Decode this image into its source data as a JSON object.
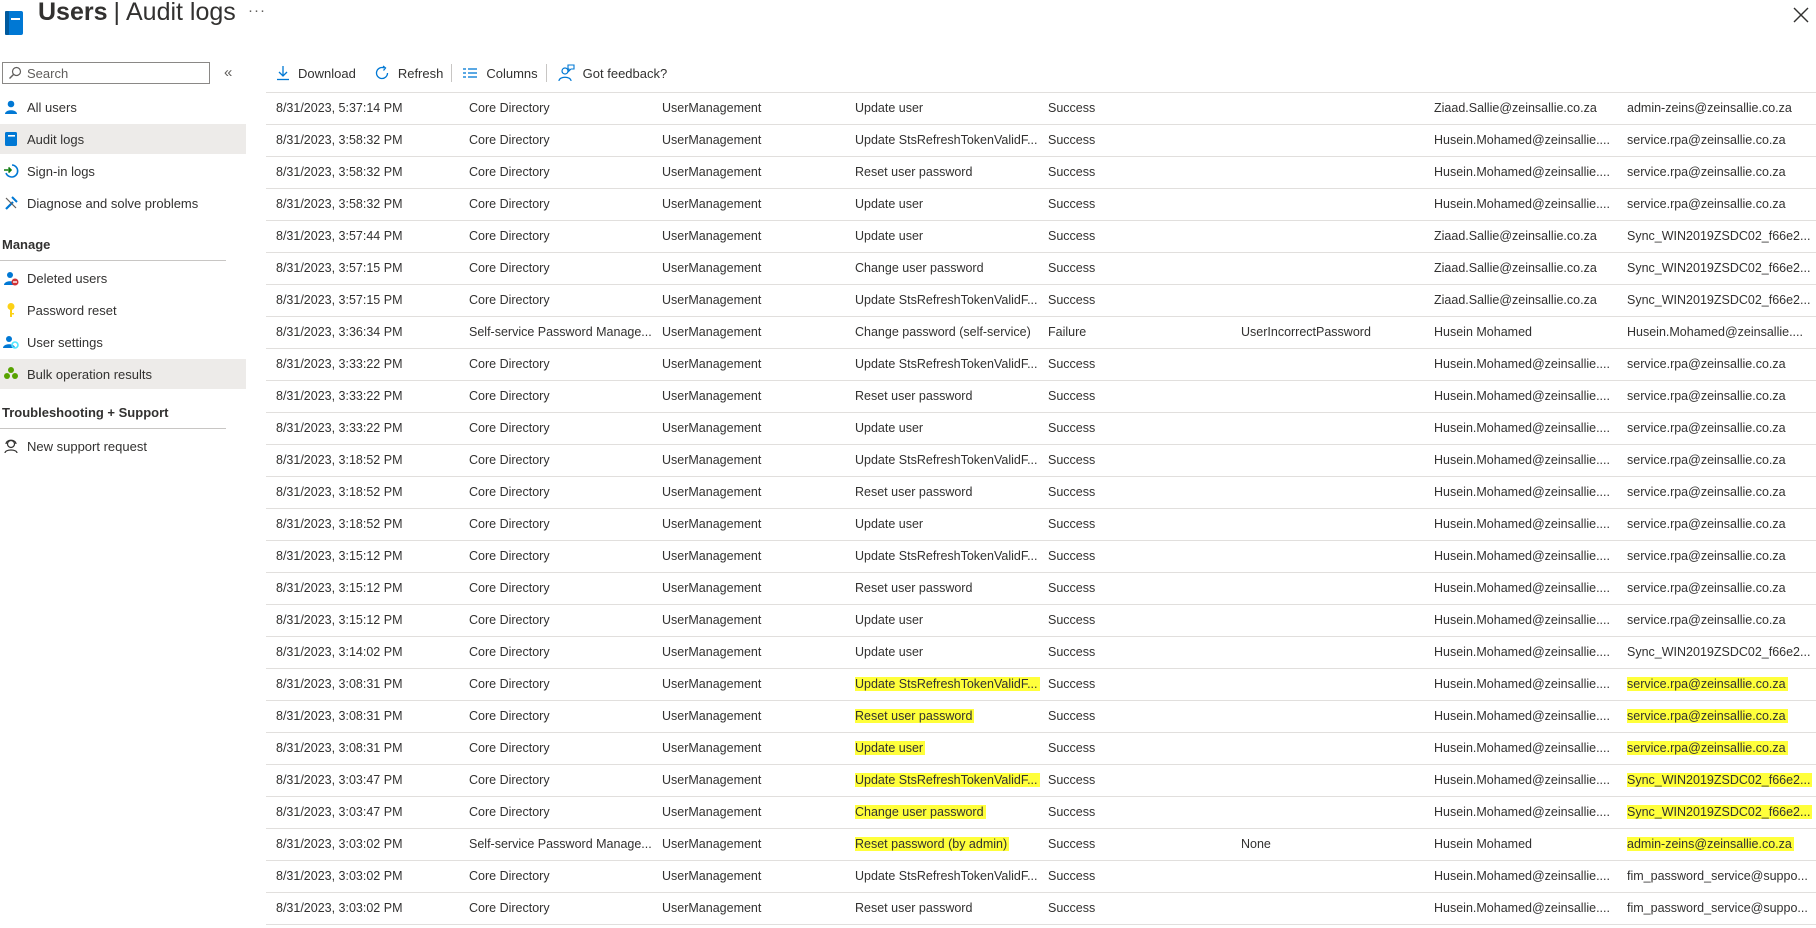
{
  "header": {
    "title_main": "Users",
    "title_sub": "Audit logs",
    "more_label": "···"
  },
  "sidebar": {
    "search_placeholder": "Search",
    "items": [
      {
        "label": "All users"
      },
      {
        "label": "Audit logs"
      },
      {
        "label": "Sign-in logs"
      },
      {
        "label": "Diagnose and solve problems"
      }
    ],
    "manage_title": "Manage",
    "manage_items": [
      {
        "label": "Deleted users"
      },
      {
        "label": "Password reset"
      },
      {
        "label": "User settings"
      },
      {
        "label": "Bulk operation results"
      }
    ],
    "support_title": "Troubleshooting + Support",
    "support_items": [
      {
        "label": "New support request"
      }
    ]
  },
  "toolbar": {
    "download": "Download",
    "refresh": "Refresh",
    "columns": "Columns",
    "feedback": "Got feedback?"
  },
  "colors": {
    "accent": "#0078d4",
    "highlight": "#ffff3b",
    "border": "#e1dfdd"
  },
  "rows": [
    [
      "8/31/2023, 5:37:14 PM",
      "Core Directory",
      "UserManagement",
      "Update user",
      "Success",
      "",
      "Ziaad.Sallie@zeinsallie.co.za",
      "admin-zeins@zeinsallie.co.za"
    ],
    [
      "8/31/2023, 3:58:32 PM",
      "Core Directory",
      "UserManagement",
      "Update StsRefreshTokenValidF...",
      "Success",
      "",
      "Husein.Mohamed@zeinsallie....",
      "service.rpa@zeinsallie.co.za"
    ],
    [
      "8/31/2023, 3:58:32 PM",
      "Core Directory",
      "UserManagement",
      "Reset user password",
      "Success",
      "",
      "Husein.Mohamed@zeinsallie....",
      "service.rpa@zeinsallie.co.za"
    ],
    [
      "8/31/2023, 3:58:32 PM",
      "Core Directory",
      "UserManagement",
      "Update user",
      "Success",
      "",
      "Husein.Mohamed@zeinsallie....",
      "service.rpa@zeinsallie.co.za"
    ],
    [
      "8/31/2023, 3:57:44 PM",
      "Core Directory",
      "UserManagement",
      "Update user",
      "Success",
      "",
      "Ziaad.Sallie@zeinsallie.co.za",
      "Sync_WIN2019ZSDC02_f66e2..."
    ],
    [
      "8/31/2023, 3:57:15 PM",
      "Core Directory",
      "UserManagement",
      "Change user password",
      "Success",
      "",
      "Ziaad.Sallie@zeinsallie.co.za",
      "Sync_WIN2019ZSDC02_f66e2..."
    ],
    [
      "8/31/2023, 3:57:15 PM",
      "Core Directory",
      "UserManagement",
      "Update StsRefreshTokenValidF...",
      "Success",
      "",
      "Ziaad.Sallie@zeinsallie.co.za",
      "Sync_WIN2019ZSDC02_f66e2..."
    ],
    [
      "8/31/2023, 3:36:34 PM",
      "Self-service Password Manage...",
      "UserManagement",
      "Change password (self-service)",
      "Failure",
      "UserIncorrectPassword",
      "Husein Mohamed",
      "Husein.Mohamed@zeinsallie...."
    ],
    [
      "8/31/2023, 3:33:22 PM",
      "Core Directory",
      "UserManagement",
      "Update StsRefreshTokenValidF...",
      "Success",
      "",
      "Husein.Mohamed@zeinsallie....",
      "service.rpa@zeinsallie.co.za"
    ],
    [
      "8/31/2023, 3:33:22 PM",
      "Core Directory",
      "UserManagement",
      "Reset user password",
      "Success",
      "",
      "Husein.Mohamed@zeinsallie....",
      "service.rpa@zeinsallie.co.za"
    ],
    [
      "8/31/2023, 3:33:22 PM",
      "Core Directory",
      "UserManagement",
      "Update user",
      "Success",
      "",
      "Husein.Mohamed@zeinsallie....",
      "service.rpa@zeinsallie.co.za"
    ],
    [
      "8/31/2023, 3:18:52 PM",
      "Core Directory",
      "UserManagement",
      "Update StsRefreshTokenValidF...",
      "Success",
      "",
      "Husein.Mohamed@zeinsallie....",
      "service.rpa@zeinsallie.co.za"
    ],
    [
      "8/31/2023, 3:18:52 PM",
      "Core Directory",
      "UserManagement",
      "Reset user password",
      "Success",
      "",
      "Husein.Mohamed@zeinsallie....",
      "service.rpa@zeinsallie.co.za"
    ],
    [
      "8/31/2023, 3:18:52 PM",
      "Core Directory",
      "UserManagement",
      "Update user",
      "Success",
      "",
      "Husein.Mohamed@zeinsallie....",
      "service.rpa@zeinsallie.co.za"
    ],
    [
      "8/31/2023, 3:15:12 PM",
      "Core Directory",
      "UserManagement",
      "Update StsRefreshTokenValidF...",
      "Success",
      "",
      "Husein.Mohamed@zeinsallie....",
      "service.rpa@zeinsallie.co.za"
    ],
    [
      "8/31/2023, 3:15:12 PM",
      "Core Directory",
      "UserManagement",
      "Reset user password",
      "Success",
      "",
      "Husein.Mohamed@zeinsallie....",
      "service.rpa@zeinsallie.co.za"
    ],
    [
      "8/31/2023, 3:15:12 PM",
      "Core Directory",
      "UserManagement",
      "Update user",
      "Success",
      "",
      "Husein.Mohamed@zeinsallie....",
      "service.rpa@zeinsallie.co.za"
    ],
    [
      "8/31/2023, 3:14:02 PM",
      "Core Directory",
      "UserManagement",
      "Update user",
      "Success",
      "",
      "Husein.Mohamed@zeinsallie....",
      "Sync_WIN2019ZSDC02_f66e2..."
    ],
    [
      "8/31/2023, 3:08:31 PM",
      "Core Directory",
      "UserManagement",
      "Update StsRefreshTokenValidF...",
      "Success",
      "",
      "Husein.Mohamed@zeinsallie....",
      "service.rpa@zeinsallie.co.za"
    ],
    [
      "8/31/2023, 3:08:31 PM",
      "Core Directory",
      "UserManagement",
      "Reset user password",
      "Success",
      "",
      "Husein.Mohamed@zeinsallie....",
      "service.rpa@zeinsallie.co.za"
    ],
    [
      "8/31/2023, 3:08:31 PM",
      "Core Directory",
      "UserManagement",
      "Update user",
      "Success",
      "",
      "Husein.Mohamed@zeinsallie....",
      "service.rpa@zeinsallie.co.za"
    ],
    [
      "8/31/2023, 3:03:47 PM",
      "Core Directory",
      "UserManagement",
      "Update StsRefreshTokenValidF...",
      "Success",
      "",
      "Husein.Mohamed@zeinsallie....",
      "Sync_WIN2019ZSDC02_f66e2..."
    ],
    [
      "8/31/2023, 3:03:47 PM",
      "Core Directory",
      "UserManagement",
      "Change user password",
      "Success",
      "",
      "Husein.Mohamed@zeinsallie....",
      "Sync_WIN2019ZSDC02_f66e2..."
    ],
    [
      "8/31/2023, 3:03:02 PM",
      "Self-service Password Manage...",
      "UserManagement",
      "Reset password (by admin)",
      "Success",
      "None",
      "Husein Mohamed",
      "admin-zeins@zeinsallie.co.za"
    ],
    [
      "8/31/2023, 3:03:02 PM",
      "Core Directory",
      "UserManagement",
      "Update StsRefreshTokenValidF...",
      "Success",
      "",
      "Husein.Mohamed@zeinsallie....",
      "fim_password_service@suppo..."
    ],
    [
      "8/31/2023, 3:03:02 PM",
      "Core Directory",
      "UserManagement",
      "Reset user password",
      "Success",
      "",
      "Husein.Mohamed@zeinsallie....",
      "fim_password_service@suppo..."
    ]
  ],
  "highlighted_rows": [
    18,
    19,
    20,
    21,
    22,
    23
  ],
  "highlighted_columns": [
    3,
    7
  ]
}
